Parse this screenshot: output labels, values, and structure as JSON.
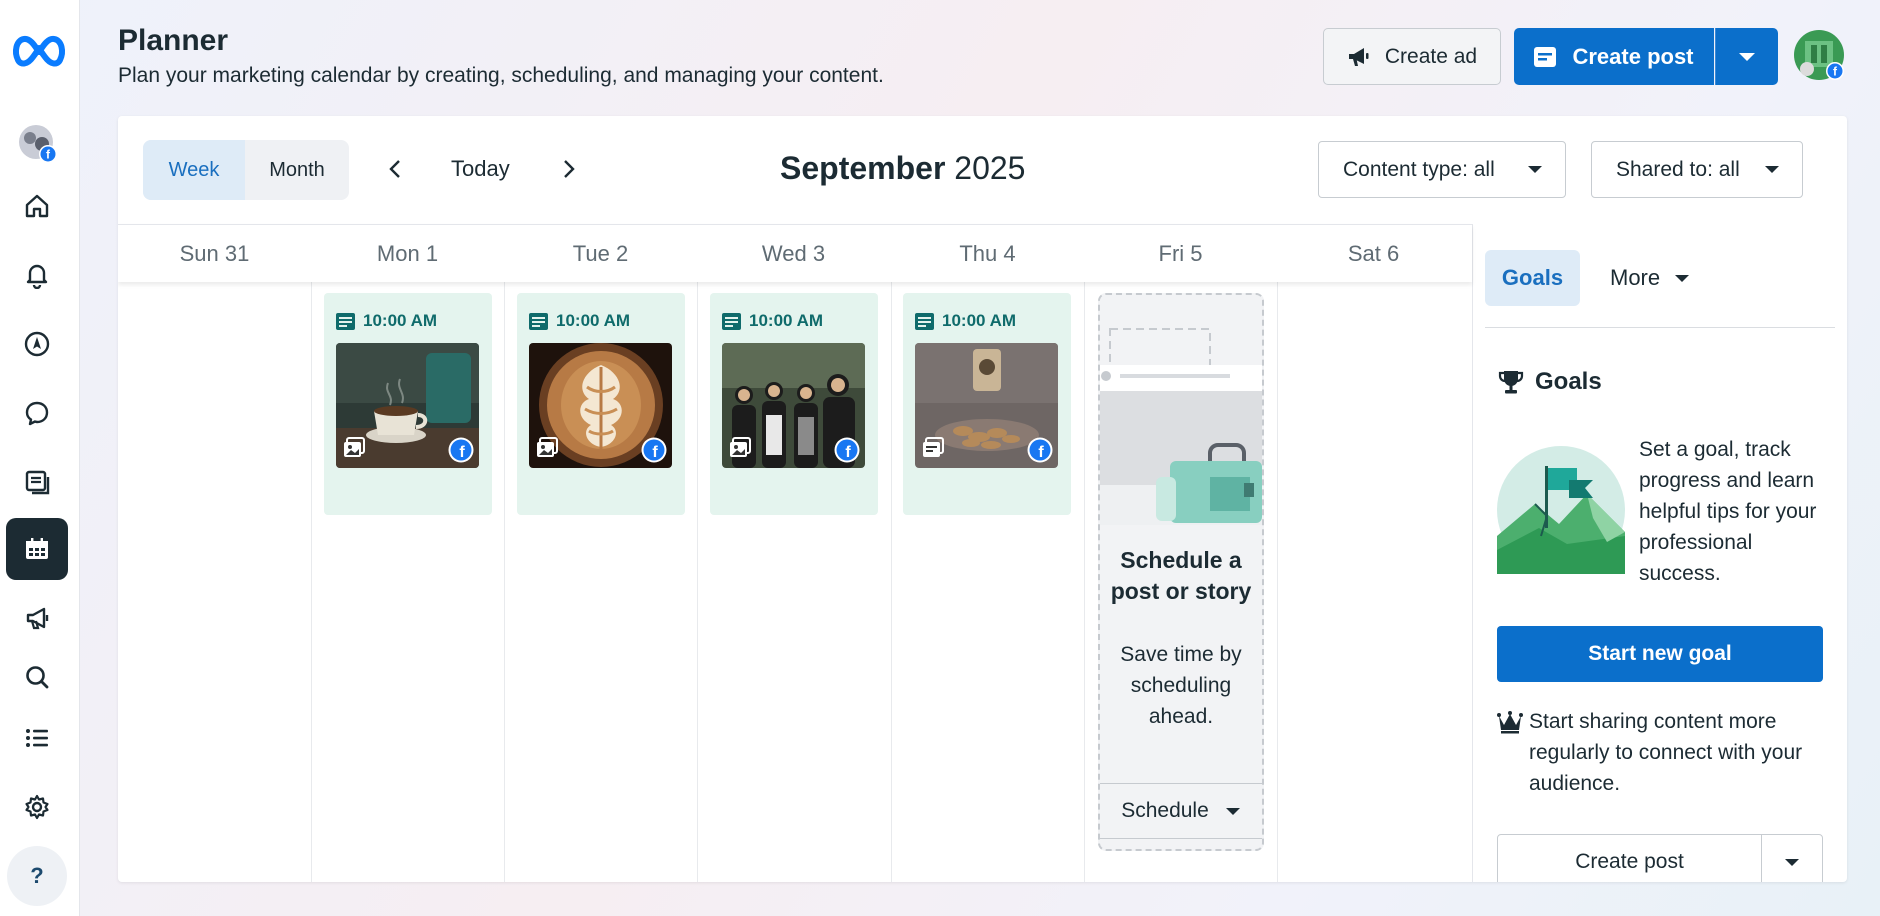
{
  "header": {
    "title": "Planner",
    "subtitle": "Plan your marketing calendar by creating, scheduling, and managing your content.",
    "create_ad_label": "Create ad",
    "create_post_label": "Create post"
  },
  "nav": {
    "items": [
      "home-icon",
      "bell-icon",
      "compass-icon",
      "chat-icon",
      "content-icon",
      "planner-icon",
      "megaphone-icon",
      "search-icon",
      "list-icon",
      "gear-icon"
    ],
    "active": "planner-icon",
    "help_label": "?"
  },
  "toolbar": {
    "view_week": "Week",
    "view_month": "Month",
    "active_view": "Week",
    "today_label": "Today",
    "month_name": "September",
    "year": "2025",
    "content_filter": "Content type: all",
    "shared_filter": "Shared to: all"
  },
  "calendar": {
    "days": [
      "Sun 31",
      "Mon 1",
      "Tue 2",
      "Wed 3",
      "Thu 4",
      "Fri 5",
      "Sat 6"
    ],
    "posts": [
      {
        "day": "Mon 1",
        "time": "10:00 AM",
        "type": "photo-post",
        "thumb": "coffee-cup"
      },
      {
        "day": "Tue 2",
        "time": "10:00 AM",
        "type": "photo-post",
        "thumb": "latte-art"
      },
      {
        "day": "Wed 3",
        "time": "10:00 AM",
        "type": "photo-post",
        "thumb": "team-photo"
      },
      {
        "day": "Thu 4",
        "time": "10:00 AM",
        "type": "text-post",
        "thumb": "food-plate"
      }
    ],
    "schedule_card": {
      "title": "Schedule a post or story",
      "description": "Save time by scheduling ahead.",
      "button_label": "Schedule"
    }
  },
  "sidebar": {
    "tab_goals": "Goals",
    "tab_more": "More",
    "goals_heading": "Goals",
    "goals_text": "Set a goal, track progress and learn helpful tips for your professional success.",
    "start_goal_label": "Start new goal",
    "tip_text": "Start sharing content more regularly to connect with your audience.",
    "create_post_label": "Create post"
  },
  "colors": {
    "brand_blue": "#0b6fcb",
    "card_green": "#e4f4ee",
    "time_teal": "#0f6b6b",
    "dark_rail": "#1c2b33"
  }
}
